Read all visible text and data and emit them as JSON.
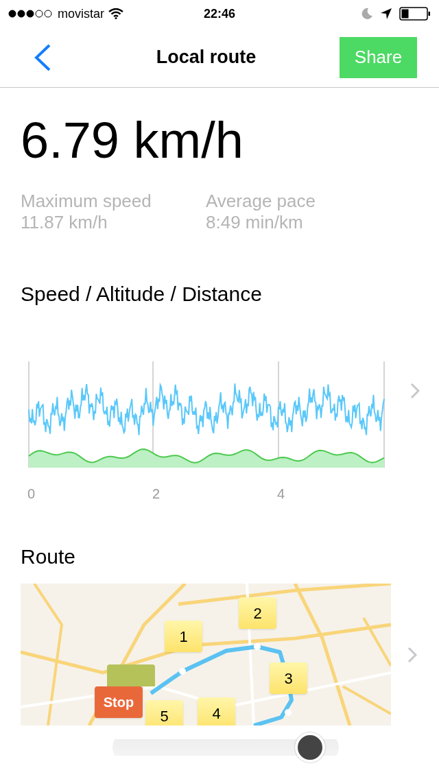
{
  "status_bar": {
    "carrier": "movistar",
    "time": "22:46"
  },
  "nav": {
    "title": "Local route",
    "share_button": "Share"
  },
  "current_speed": "6.79 km/h",
  "stats": [
    {
      "label": "Maximum speed",
      "value": "11.87 km/h"
    },
    {
      "label": "Average pace",
      "value": "8:49 min/km"
    }
  ],
  "chart_section": {
    "title": "Speed / Altitude / Distance",
    "x_labels": [
      "0",
      "2",
      "4"
    ]
  },
  "route_section": {
    "title": "Route",
    "pins": [
      {
        "kind": "lap",
        "label": "2"
      },
      {
        "kind": "lap",
        "label": "1"
      },
      {
        "kind": "lap",
        "label": "3"
      },
      {
        "kind": "start"
      },
      {
        "kind": "stop",
        "label": "Stop"
      },
      {
        "kind": "lap",
        "label": "5"
      },
      {
        "kind": "lap",
        "label": "4"
      }
    ]
  },
  "slider": {
    "level": 0.93
  }
}
